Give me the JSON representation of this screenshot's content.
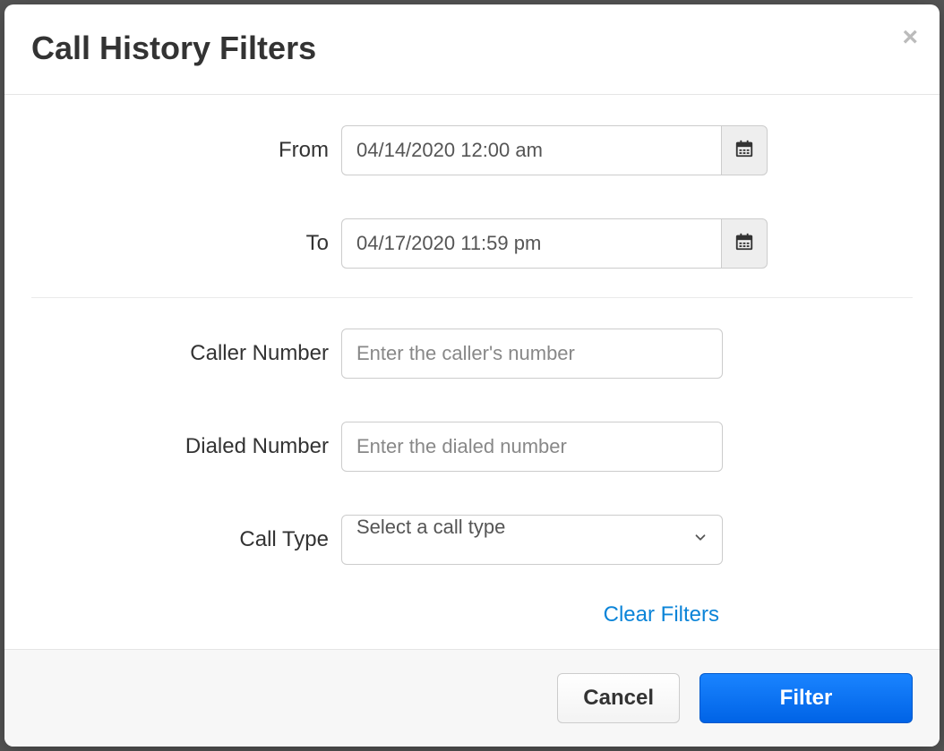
{
  "modal": {
    "title": "Call History Filters",
    "fields": {
      "from": {
        "label": "From",
        "value": "04/14/2020 12:00 am"
      },
      "to": {
        "label": "To",
        "value": "04/17/2020 11:59 pm"
      },
      "caller": {
        "label": "Caller Number",
        "placeholder": "Enter the caller's number",
        "value": ""
      },
      "dialed": {
        "label": "Dialed Number",
        "placeholder": "Enter the dialed number",
        "value": ""
      },
      "call_type": {
        "label": "Call Type",
        "placeholder": "Select a call type",
        "value": ""
      }
    },
    "clear_filters": "Clear Filters",
    "footer": {
      "cancel": "Cancel",
      "filter": "Filter"
    }
  }
}
